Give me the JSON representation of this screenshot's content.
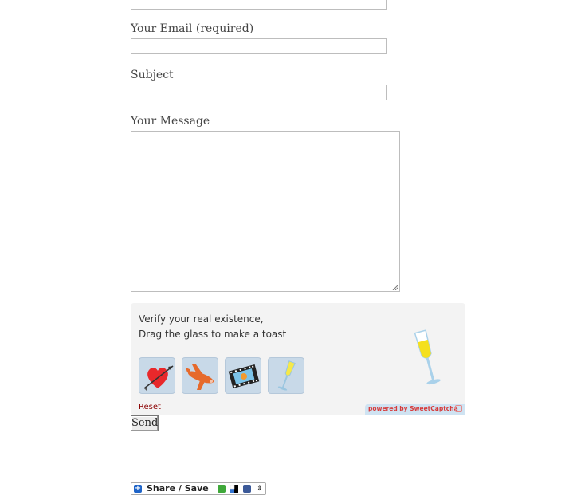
{
  "form": {
    "email_label": "Your Email (required)",
    "subject_label": "Subject",
    "message_label": "Your Message",
    "email_value": "",
    "subject_value": "",
    "message_value": "",
    "send_label": "Send"
  },
  "captcha": {
    "line1": "Verify your real existence,",
    "line2": "Drag the glass to make a toast",
    "options": [
      "heart-arrow-icon",
      "airplane-icon",
      "film-reel-icon",
      "champagne-glass-icon"
    ],
    "target": "champagne-glass-icon",
    "reset_label": "Reset",
    "powered_by": "powered by SweetCaptcha"
  },
  "share": {
    "label": "Share / Save",
    "icons": [
      "plus-icon",
      "google-icon",
      "delicious-icon",
      "facebook-icon",
      "updown-arrows-icon"
    ]
  },
  "colors": {
    "tile_bg": "#c8d9e8",
    "captcha_bg": "#f3f3f3",
    "reset": "#8b0000",
    "powered_text": "#d63a3a"
  }
}
